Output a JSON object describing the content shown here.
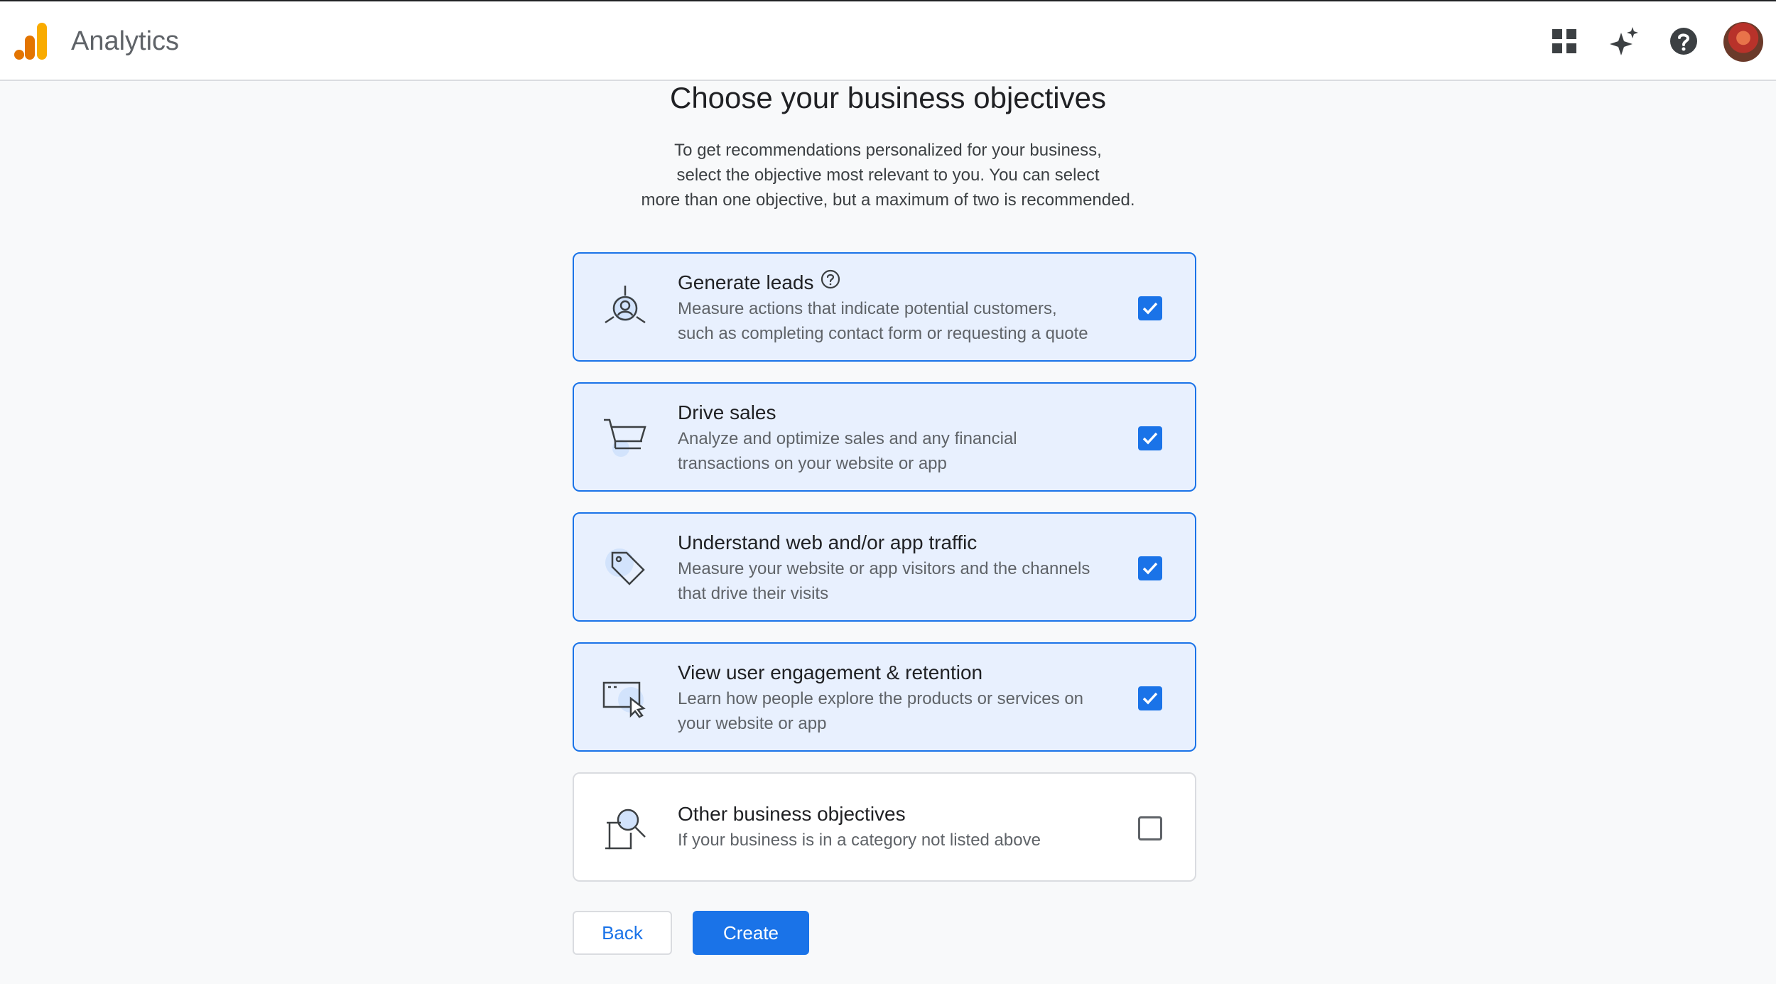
{
  "header": {
    "app_title": "Analytics",
    "icons": [
      "apps-grid-icon",
      "sparkle-icon",
      "help-icon",
      "account-avatar"
    ]
  },
  "main": {
    "title": "Choose your business objectives",
    "intro_lines": [
      "To get recommendations personalized for your business,",
      "select the objective most relevant to you. You can select",
      "more than one objective, but a maximum of two is recommended."
    ],
    "objectives": [
      {
        "title": "Generate leads",
        "desc_lines": [
          "Measure actions that indicate potential customers,",
          "such as completing contact form or requesting a quote"
        ],
        "checked": true,
        "icon": "leads-icon"
      },
      {
        "title": "Drive sales",
        "desc_lines": [
          "Analyze and optimize sales and any financial",
          "transactions on your website or app"
        ],
        "checked": true,
        "icon": "cart-icon"
      },
      {
        "title": "Understand web and/or app traffic",
        "desc_lines": [
          "Measure your website or app visitors and the channels",
          "that drive their visits"
        ],
        "checked": true,
        "icon": "tag-icon"
      },
      {
        "title": "View user engagement & retention",
        "desc_lines": [
          "Learn how people explore the products or services on",
          "your website or app"
        ],
        "checked": true,
        "icon": "screen-cursor-icon"
      },
      {
        "title": "Other business objectives",
        "desc_lines": [
          "If your business is in a category not listed above"
        ],
        "checked": false,
        "icon": "search-doc-icon"
      }
    ],
    "back_label": "Back",
    "create_label": "Create"
  },
  "colors": {
    "accent": "#1a73e8",
    "selected_bg": "#e8f0fe",
    "logo_orange": "#f9ab00",
    "logo_dark_orange": "#e37400"
  }
}
